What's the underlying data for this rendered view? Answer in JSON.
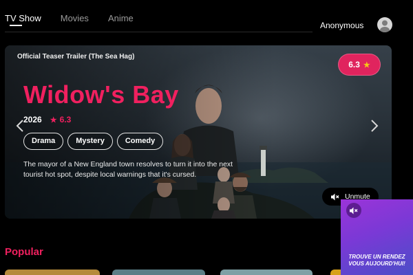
{
  "nav": {
    "tabs": [
      {
        "label": "TV Show",
        "active": true
      },
      {
        "label": "Movies",
        "active": false
      },
      {
        "label": "Anime",
        "active": false
      }
    ],
    "user_name": "Anonymous",
    "avatar_icon": "user-avatar-icon"
  },
  "hero": {
    "trailer_label": "Official Teaser Trailer (The Sea Hag)",
    "rating": "6.3",
    "title": "Widow's Bay",
    "year": "2026",
    "score": "6.3",
    "genres": [
      "Drama",
      "Mystery",
      "Comedy"
    ],
    "description": "The mayor of a New England town resolves to turn it into the next tourist hot spot, despite local warnings that it's cursed.",
    "unmute_label": "Unmute",
    "accent_color": "#f0205f",
    "rating_pill_color": "#e0245e",
    "star_color": "#f5c518"
  },
  "popular": {
    "title": "Popular"
  },
  "ad": {
    "text_line1": "TROUVE UN RENDEZ",
    "text_line2": "VOUS AUJOURD'HUI!"
  }
}
